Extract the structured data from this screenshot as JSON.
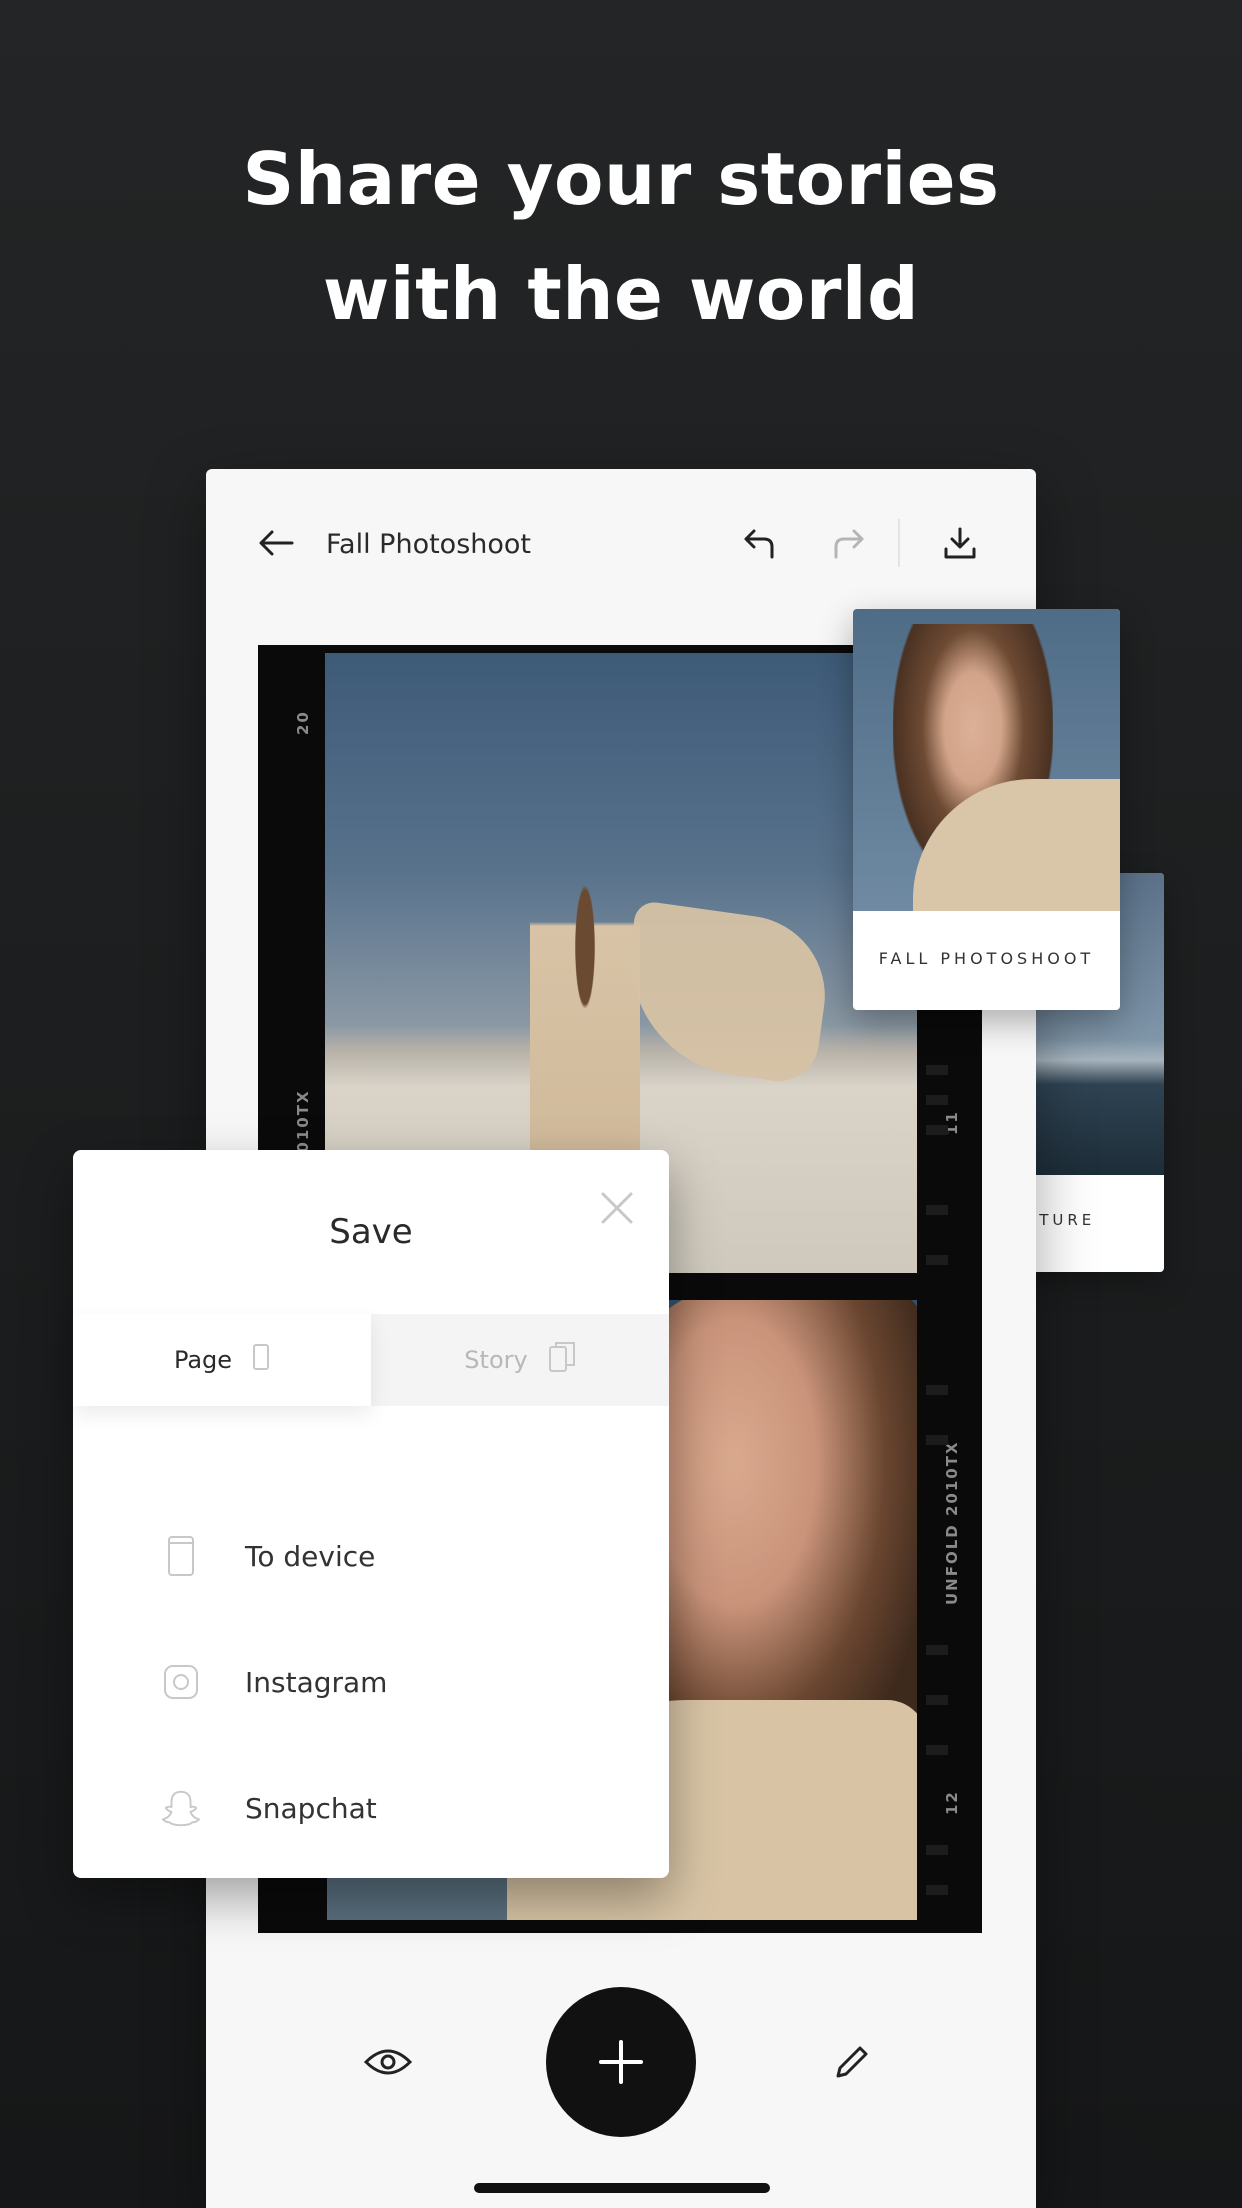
{
  "headline": {
    "line1": "Share your stories",
    "line2": "with the world"
  },
  "editor": {
    "title": "Fall Photoshoot",
    "icons": {
      "back": "arrow-left-icon",
      "undo": "undo-icon",
      "redo": "redo-icon",
      "download": "download-icon"
    }
  },
  "film": {
    "frame_top": "20",
    "code_left": "2010TX",
    "frame_mid": "11",
    "brand_right": "UNFOLD 2010TX",
    "frame_bottom": "12"
  },
  "cards": {
    "front_label": "FALL PHOTOSHOOT",
    "back_label": "NTURE"
  },
  "save_modal": {
    "title": "Save",
    "tabs": [
      {
        "label": "Page",
        "selected": true,
        "icon": "single-page-icon"
      },
      {
        "label": "Story",
        "selected": false,
        "icon": "multi-page-icon"
      }
    ],
    "options": [
      {
        "label": "To device",
        "icon": "phone-icon"
      },
      {
        "label": "Instagram",
        "icon": "instagram-icon"
      },
      {
        "label": "Snapchat",
        "icon": "snapchat-icon"
      }
    ]
  },
  "bottom_bar": {
    "icons": [
      "eye-icon",
      "plus-icon",
      "pencil-icon"
    ]
  },
  "colors": {
    "background": "#1f2122",
    "panel": "#f7f7f7",
    "fab": "#111111",
    "accent_text": "#2a2a2a"
  }
}
